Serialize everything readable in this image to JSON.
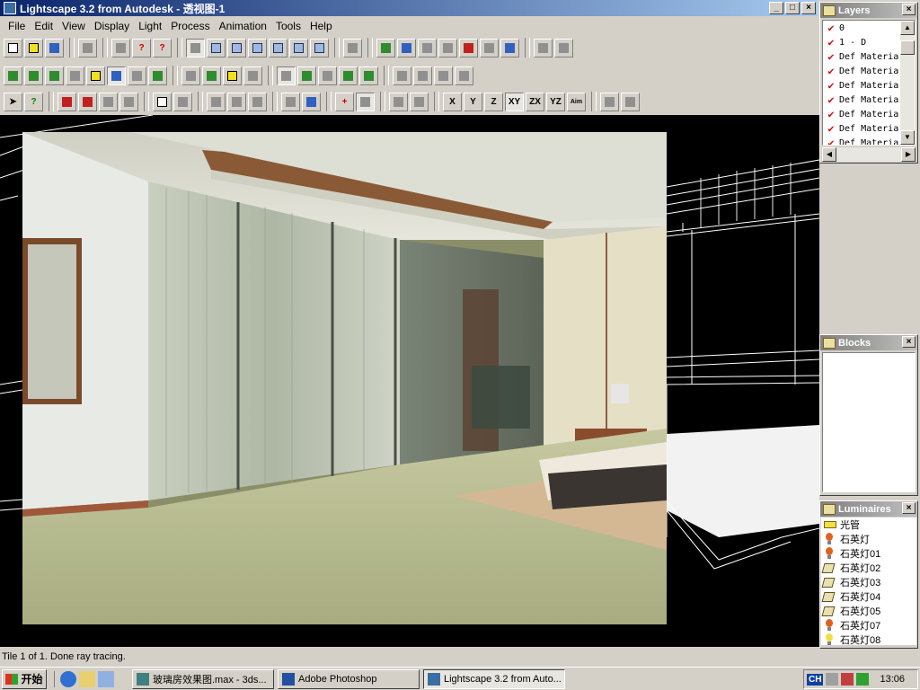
{
  "window": {
    "title": "Lightscape 3.2 from Autodesk - 透视图-1"
  },
  "menu": [
    "File",
    "Edit",
    "View",
    "Display",
    "Light",
    "Process",
    "Animation",
    "Tools",
    "Help"
  ],
  "toolbar_axes": {
    "x": "X",
    "y": "Y",
    "z": "Z",
    "xy": "XY",
    "zx": "ZX",
    "yz": "YZ",
    "aim": "Aim"
  },
  "layers": {
    "title": "Layers",
    "items": [
      "0",
      "1 - D",
      "Def Materia",
      "Def Materia",
      "Def Materia",
      "Def Materia",
      "Def Materia",
      "Def Materia",
      "Def Materia"
    ]
  },
  "blocks": {
    "title": "Blocks"
  },
  "luminaires": {
    "title": "Luminaires",
    "items": [
      {
        "label": "光管",
        "icon": "tube-light-icon"
      },
      {
        "label": "石英灯",
        "icon": "red-bulb-icon"
      },
      {
        "label": "石英灯01",
        "icon": "red-bulb-icon"
      },
      {
        "label": "石英灯02",
        "icon": "spot-lamp-icon"
      },
      {
        "label": "石英灯03",
        "icon": "spot-lamp-icon"
      },
      {
        "label": "石英灯04",
        "icon": "spot-lamp-icon"
      },
      {
        "label": "石英灯05",
        "icon": "spot-lamp-icon"
      },
      {
        "label": "石英灯07",
        "icon": "red-bulb-icon"
      },
      {
        "label": "石英灯08",
        "icon": "yellow-bulb-icon"
      }
    ]
  },
  "status": "Tile 1 of 1. Done ray tracing.",
  "taskbar": {
    "start": "开始",
    "tasks": [
      "玻璃房效果图.max - 3ds...",
      "Adobe Photoshop",
      "Lightscape 3.2 from Auto..."
    ],
    "input_lang": "CH",
    "clock": "13:06"
  },
  "colors": {
    "title_active": "#0a246a",
    "panel_title": "#808080",
    "face": "#d4d0c8"
  }
}
